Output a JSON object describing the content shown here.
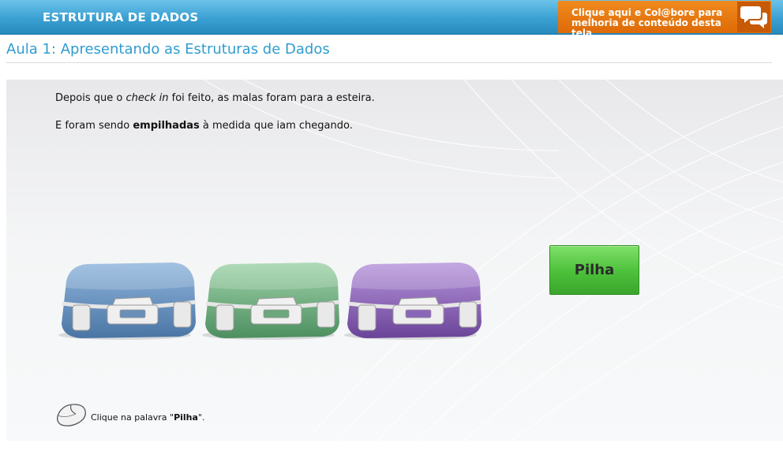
{
  "header": {
    "course_title": "ESTRUTURA DE DADOS",
    "collaborate_line1": "Clique aqui e Col@bore para",
    "collaborate_line2": "melhoria de conteúdo desta tela",
    "collaborate_icon": "speech-bubbles-icon"
  },
  "lesson": {
    "title": "Aula 1: Apresentando as Estruturas de Dados"
  },
  "content": {
    "p1_before": "Depois que o ",
    "p1_italic": "check in",
    "p1_after": " foi feito, as malas foram para a esteira.",
    "p2_before": "E foram sendo ",
    "p2_bold": "empilhadas",
    "p2_after": " à medida que iam chegando.",
    "suitcases": [
      {
        "color": "blue",
        "hex": "#5b86b4"
      },
      {
        "color": "green",
        "hex": "#5e9f72"
      },
      {
        "color": "purple",
        "hex": "#7a55a8"
      }
    ],
    "stack_button_label": "Pilha",
    "stack_button_color": "#4cc03a"
  },
  "hint": {
    "icon": "mouse-icon",
    "before": "Clique na palavra \"",
    "bold": "Pilha",
    "after": "\"."
  }
}
